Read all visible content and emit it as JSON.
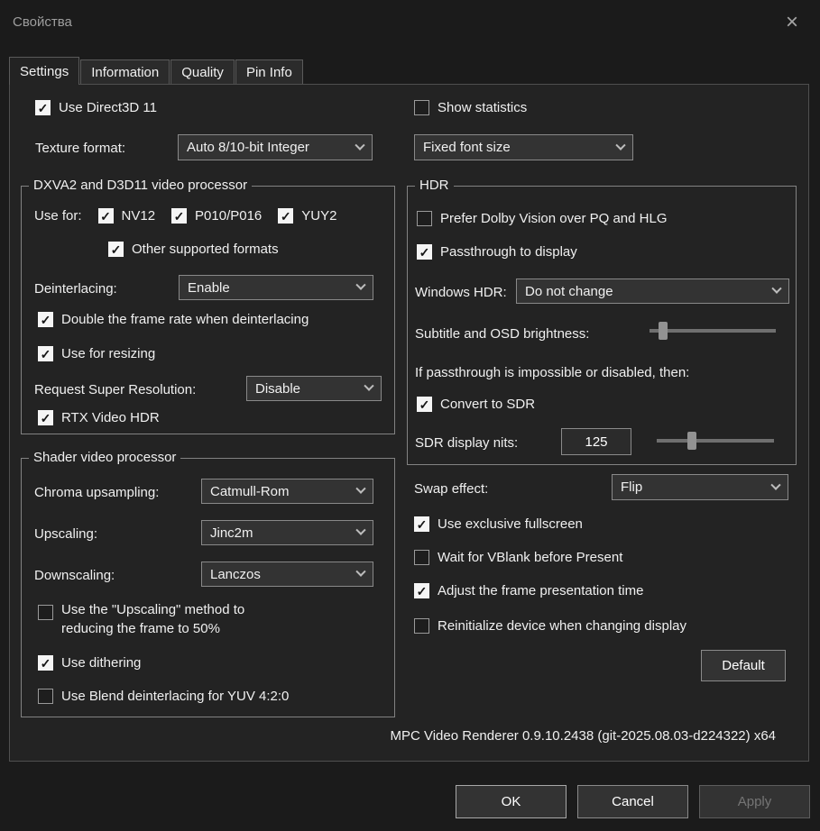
{
  "window": {
    "title": "Свойства"
  },
  "icons": {
    "close": "×"
  },
  "tabs": [
    {
      "label": "Settings"
    },
    {
      "label": "Information"
    },
    {
      "label": "Quality"
    },
    {
      "label": "Pin Info"
    }
  ],
  "settings": {
    "left": {
      "use_d3d11": {
        "label": "Use Direct3D 11",
        "checked": true
      },
      "texture_format": {
        "label": "Texture format:",
        "value": "Auto 8/10-bit Integer"
      },
      "dxva_group": {
        "title": "DXVA2 and D3D11 video processor",
        "use_for_label": "Use for:",
        "formats": [
          {
            "label": "NV12",
            "checked": true
          },
          {
            "label": "P010/P016",
            "checked": true
          },
          {
            "label": "YUY2",
            "checked": true
          }
        ],
        "other_formats": {
          "label": "Other supported formats",
          "checked": true
        },
        "deinterlacing": {
          "label": "Deinterlacing:",
          "value": "Enable"
        },
        "double_frame_rate": {
          "label": "Double the frame rate when deinterlacing",
          "checked": true
        },
        "use_for_resizing": {
          "label": "Use for resizing",
          "checked": true
        },
        "super_resolution": {
          "label": "Request Super Resolution:",
          "value": "Disable"
        },
        "rtx_video_hdr": {
          "label": "RTX Video HDR",
          "checked": true
        }
      },
      "shader_group": {
        "title": "Shader video processor",
        "chroma_upsampling": {
          "label": "Chroma upsampling:",
          "value": "Catmull-Rom"
        },
        "upscaling": {
          "label": "Upscaling:",
          "value": "Jinc2m"
        },
        "downscaling": {
          "label": "Downscaling:",
          "value": "Lanczos"
        },
        "upscaling_method_50": {
          "label": "Use the \"Upscaling\" method to reducing the frame to 50%",
          "checked": false
        },
        "use_dithering": {
          "label": "Use dithering",
          "checked": true
        },
        "blend_deinterlacing": {
          "label": "Use Blend deinterlacing for YUV 4:2:0",
          "checked": false
        }
      }
    },
    "right": {
      "show_statistics": {
        "label": "Show statistics",
        "checked": false
      },
      "font_size": {
        "value": "Fixed font size"
      },
      "hdr_group": {
        "title": "HDR",
        "prefer_dolby_vision": {
          "label": "Prefer Dolby Vision over PQ and HLG",
          "checked": false
        },
        "passthrough_to_display": {
          "label": "Passthrough to display",
          "checked": true
        },
        "windows_hdr": {
          "label": "Windows HDR:",
          "value": "Do not change"
        },
        "osd_brightness": {
          "label": "Subtitle and OSD brightness:"
        },
        "passthrough_note": "If passthrough is impossible or disabled, then:",
        "convert_to_sdr": {
          "label": "Convert to SDR",
          "checked": true
        },
        "sdr_display_nits": {
          "label": "SDR display nits:",
          "value": "125"
        }
      },
      "swap_effect": {
        "label": "Swap effect:",
        "value": "Flip"
      },
      "exclusive_fullscreen": {
        "label": "Use exclusive fullscreen",
        "checked": true
      },
      "wait_vblank": {
        "label": "Wait for VBlank before Present",
        "checked": false
      },
      "adjust_frame_time": {
        "label": "Adjust the frame presentation time",
        "checked": true
      },
      "reinit_device": {
        "label": "Reinitialize device when changing display",
        "checked": false
      },
      "default_button": "Default"
    }
  },
  "footer": {
    "version": "MPC Video Renderer 0.9.10.2438 (git-2025.08.03-d224322) x64",
    "ok": "OK",
    "cancel": "Cancel",
    "apply": "Apply"
  }
}
